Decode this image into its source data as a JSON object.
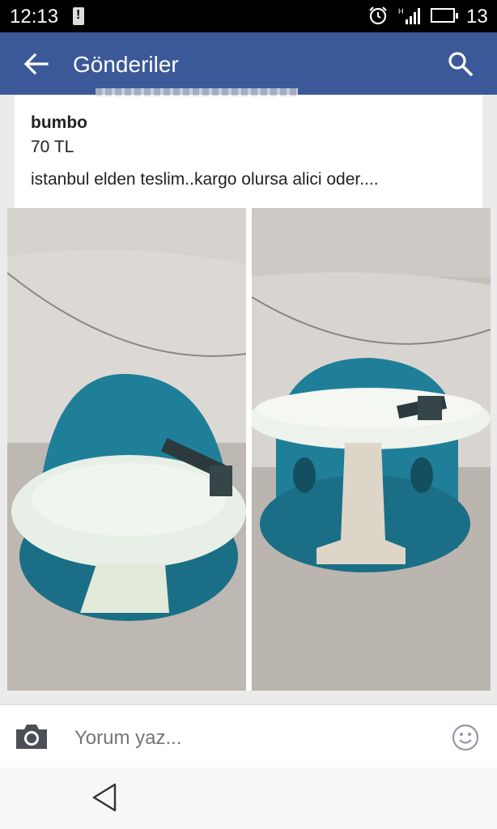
{
  "status_bar": {
    "time": "12:13",
    "battery_percent": "13",
    "icons": [
      "battery-alert-icon",
      "alarm-icon",
      "signal-h-icon",
      "battery-icon"
    ]
  },
  "app_bar": {
    "title": "Gönderiler",
    "back_icon": "arrow-left-icon",
    "search_icon": "search-icon",
    "color": "#3b5998"
  },
  "post": {
    "name": "bumbo",
    "price": "70 TL",
    "description": "istanbul elden teslim..kargo olursa alici oder...."
  },
  "gallery": {
    "photos": [
      "bumbo-seat-with-tray-photo-1",
      "bumbo-seat-with-tray-photo-2"
    ]
  },
  "composer": {
    "placeholder": "Yorum yaz...",
    "camera_icon": "camera-icon",
    "emoji_icon": "smiley-icon"
  },
  "nav_bar": {
    "back_icon": "triangle-back-icon"
  }
}
